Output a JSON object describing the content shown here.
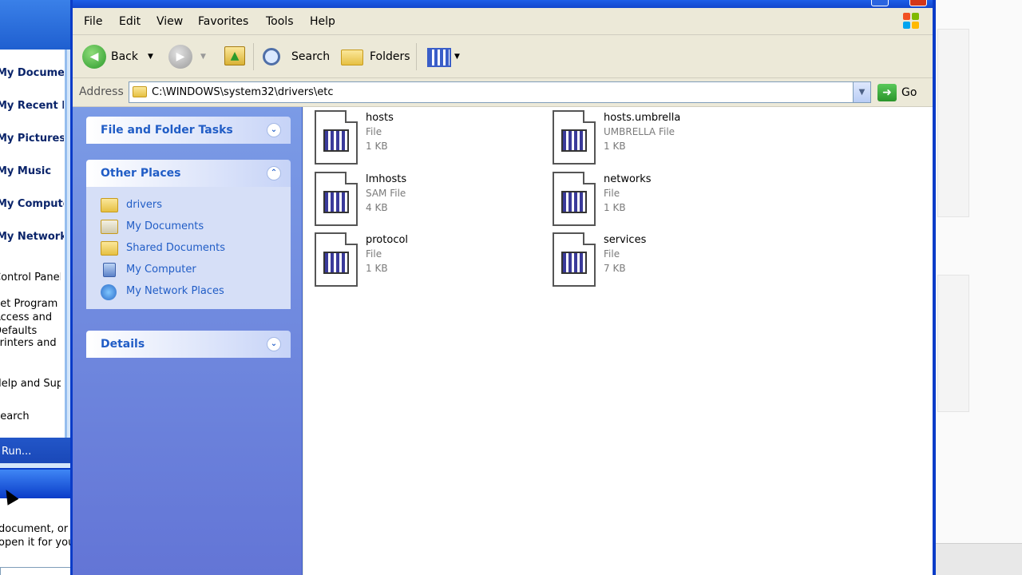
{
  "start_menu": {
    "items": [
      {
        "label": "My Documents",
        "style": "bold"
      },
      {
        "label": "My Recent Documents",
        "style": "bold"
      },
      {
        "label": "My Pictures",
        "style": "bold"
      },
      {
        "label": "My Music",
        "style": "bold"
      },
      {
        "label": "My Computer",
        "style": "bold"
      },
      {
        "label": "My Network Places",
        "style": "bold"
      },
      {
        "label": "Control Panel",
        "style": "plain"
      },
      {
        "label": "Set Program Access and Defaults",
        "style": "plain"
      },
      {
        "label": "Printers and Faxes",
        "style": "plain"
      },
      {
        "label": "Help and Support",
        "style": "plain"
      },
      {
        "label": "Search",
        "style": "plain"
      },
      {
        "label": "Run...",
        "style": "plain"
      }
    ]
  },
  "dialog": {
    "help_label": "?",
    "close_label": "✕",
    "body_line1": "document, or",
    "body_line2": "open it for you."
  },
  "menubar": {
    "items": [
      "File",
      "Edit",
      "View",
      "Favorites",
      "Tools",
      "Help"
    ]
  },
  "toolbar": {
    "back_label": "Back",
    "search_label": "Search",
    "folders_label": "Folders"
  },
  "address": {
    "label": "Address",
    "path": "C:\\WINDOWS\\system32\\drivers\\etc",
    "go_label": "Go"
  },
  "tasks": {
    "file_folder_title": "File and Folder Tasks",
    "other_places_title": "Other Places",
    "other_places": [
      "drivers",
      "My Documents",
      "Shared Documents",
      "My Computer",
      "My Network Places"
    ],
    "details_title": "Details"
  },
  "files": [
    {
      "name": "hosts",
      "type": "File",
      "size": "1 KB"
    },
    {
      "name": "hosts.umbrella",
      "type": "UMBRELLA File",
      "size": "1 KB"
    },
    {
      "name": "lmhosts",
      "type": "SAM File",
      "size": "4 KB"
    },
    {
      "name": "networks",
      "type": "File",
      "size": "1 KB"
    },
    {
      "name": "protocol",
      "type": "File",
      "size": "1 KB"
    },
    {
      "name": "services",
      "type": "File",
      "size": "7 KB"
    }
  ],
  "colors": {
    "xp_blue": "#0a3cc8",
    "task_pane": "#7b9be6",
    "link_blue": "#215dc6"
  }
}
